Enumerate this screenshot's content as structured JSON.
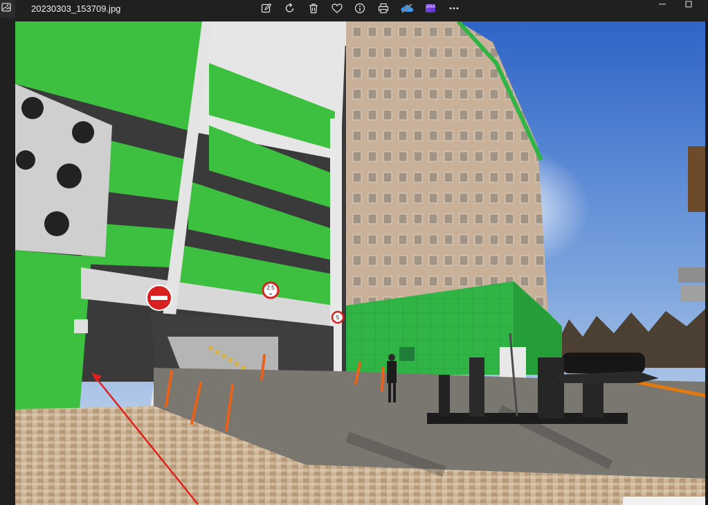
{
  "app": {
    "file_name": "20230303_153709.jpg",
    "icon": "photos-app-icon"
  },
  "toolbar": [
    {
      "name": "edit-image-button",
      "icon": "edit-image-icon"
    },
    {
      "name": "rotate-button",
      "icon": "rotate-icon"
    },
    {
      "name": "delete-button",
      "icon": "trash-icon"
    },
    {
      "name": "favorite-button",
      "icon": "heart-icon"
    },
    {
      "name": "file-info-button",
      "icon": "info-icon"
    },
    {
      "name": "print-button",
      "icon": "print-icon"
    },
    {
      "name": "onedrive-button",
      "icon": "cloud-icon"
    },
    {
      "name": "clipchamp-button",
      "icon": "clipchamp-icon"
    },
    {
      "name": "more-options-button",
      "icon": "more-icon"
    }
  ],
  "window_controls": [
    {
      "name": "minimize-button",
      "icon": "minimize-icon"
    },
    {
      "name": "maximize-button",
      "icon": "maximize-icon"
    }
  ],
  "photo": {
    "signs": {
      "height_limit": "2.5",
      "height_unit": "м",
      "speed_limit": "5"
    },
    "colors": {
      "sky_top": "#2f64c8",
      "sky_bottom": "#dde6f2",
      "parking_green": "#3cbf3c",
      "tower_beige": "#c9b29c",
      "annotation_arrow": "#e0201c"
    }
  }
}
